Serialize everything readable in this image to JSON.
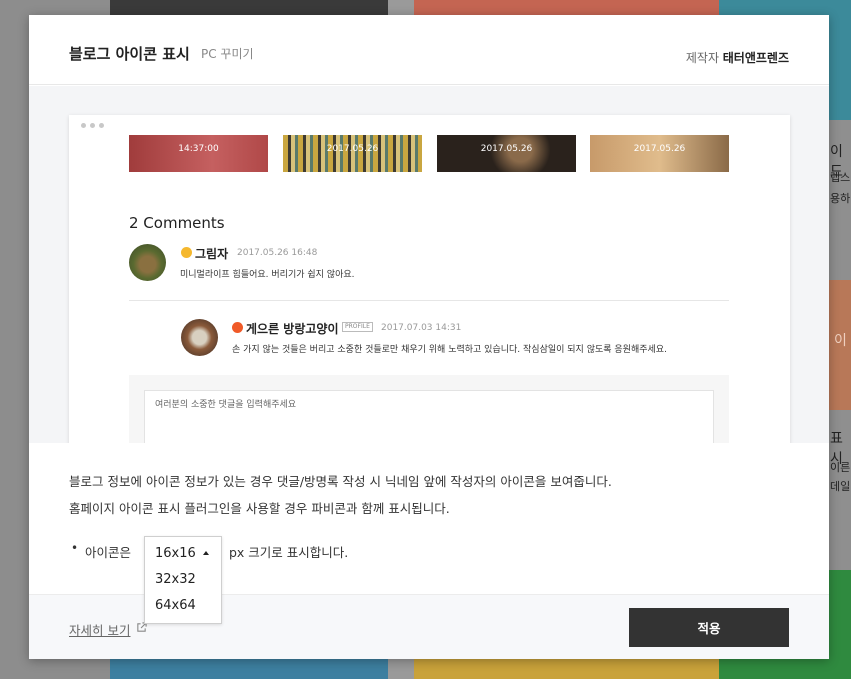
{
  "modal": {
    "title": "블로그 아이콘 표시",
    "subtitle": "PC 꾸미기",
    "author_label": "제작자",
    "author_name": "태터앤프렌즈"
  },
  "preview": {
    "thumbnails": [
      {
        "label": "14:37:00"
      },
      {
        "label": "2017.05.26"
      },
      {
        "label": "2017.05.26"
      },
      {
        "label": "2017.05.26"
      }
    ],
    "comments_title": "2 Comments",
    "comments": [
      {
        "name": "그림자",
        "date": "2017.05.26 16:48",
        "text": "미니멀라이프 힘들어요. 버리기가 쉽지 않아요.",
        "badge_color": "#f5b82e"
      },
      {
        "name": "게으른 방랑고양이",
        "tag": "PROFILE",
        "date": "2017.07.03 14:31",
        "text": "손 가지 않는 것들은 버리고 소중한 것들로만 채우기 위해 노력하고 있습니다. 작심삼일이 되지 않도록 응원해주세요.",
        "badge_color": "#f05a28"
      }
    ],
    "input_placeholder": "여러분의 소중한 댓글을 입력해주세요"
  },
  "description": {
    "line1": "블로그 정보에 아이콘 정보가 있는 경우 댓글/방명록 작성 시 닉네임 앞에 작성자의 아이콘을 보여줍니다.",
    "line2": "홈페이지 아이콘 표시 플러그인을 사용할 경우 파비콘과 함께 표시됩니다."
  },
  "icon_size": {
    "bullet": "•",
    "label": "아이콘은",
    "suffix": "px 크기로 표시합니다.",
    "selected": "16x16",
    "options": [
      "16x16",
      "32x32",
      "64x64"
    ]
  },
  "footer": {
    "more_link": "자세히 보기",
    "apply_label": "적용"
  },
  "background": {
    "right_texts": [
      "이드",
      "렙스",
      "용하",
      "이",
      "표시",
      "이른",
      "데일"
    ]
  }
}
